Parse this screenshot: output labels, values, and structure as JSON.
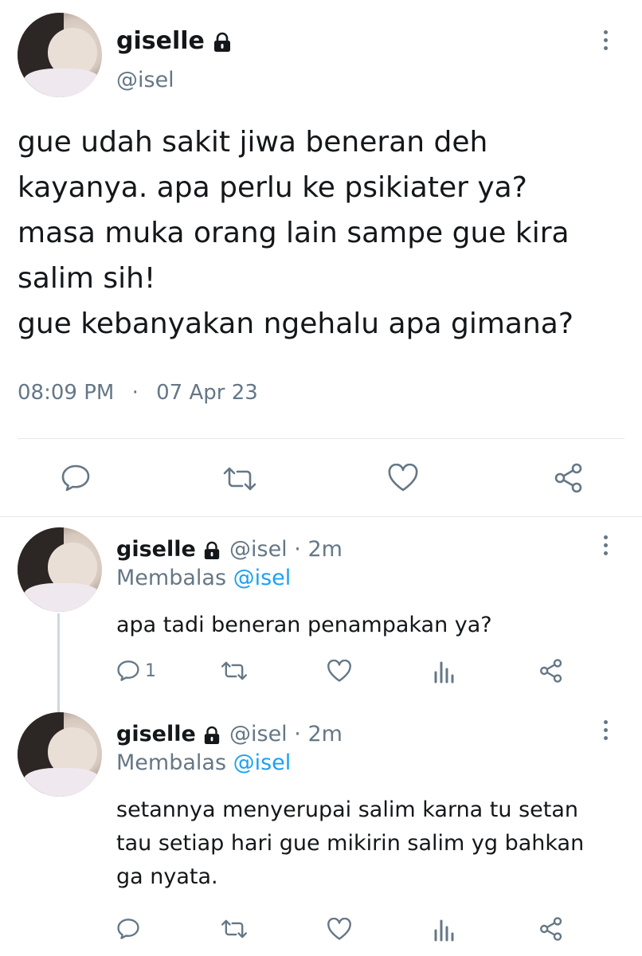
{
  "main_tweet": {
    "display_name": "giselle",
    "handle": "@isel",
    "text_lines": [
      "gue udah sakit jiwa beneran deh",
      "kayanya. apa perlu ke psikiater ya?",
      "masa muka orang lain sampe gue kira",
      "salim sih!",
      "gue kebanyakan ngehalu apa gimana?"
    ],
    "time": "08:09 PM",
    "separator": "·",
    "date": "07 Apr 23"
  },
  "replies": [
    {
      "display_name": "giselle",
      "handle": "@isel",
      "sep": "·",
      "age": "2m",
      "reply_prefix": "Membalas",
      "reply_to": "@isel",
      "text_lines": [
        "apa tadi beneran penampakan ya?"
      ],
      "reply_count": "1"
    },
    {
      "display_name": "giselle",
      "handle": "@isel",
      "sep": "·",
      "age": "2m",
      "reply_prefix": "Membalas",
      "reply_to": "@isel",
      "text_lines": [
        "setannya menyerupai salim karna tu setan",
        "tau setiap hari gue mikirin salim yg bahkan",
        "ga nyata."
      ],
      "reply_count": ""
    }
  ],
  "icons": {
    "lock": "lock-icon",
    "more": "more-vertical-icon",
    "reply": "reply-icon",
    "retweet": "retweet-icon",
    "like": "heart-icon",
    "stats": "analytics-icon",
    "share": "share-icon"
  },
  "colors": {
    "text": "#14171a",
    "secondary": "#657786",
    "accent": "#1da1f2",
    "divider": "#e1e8ed"
  }
}
